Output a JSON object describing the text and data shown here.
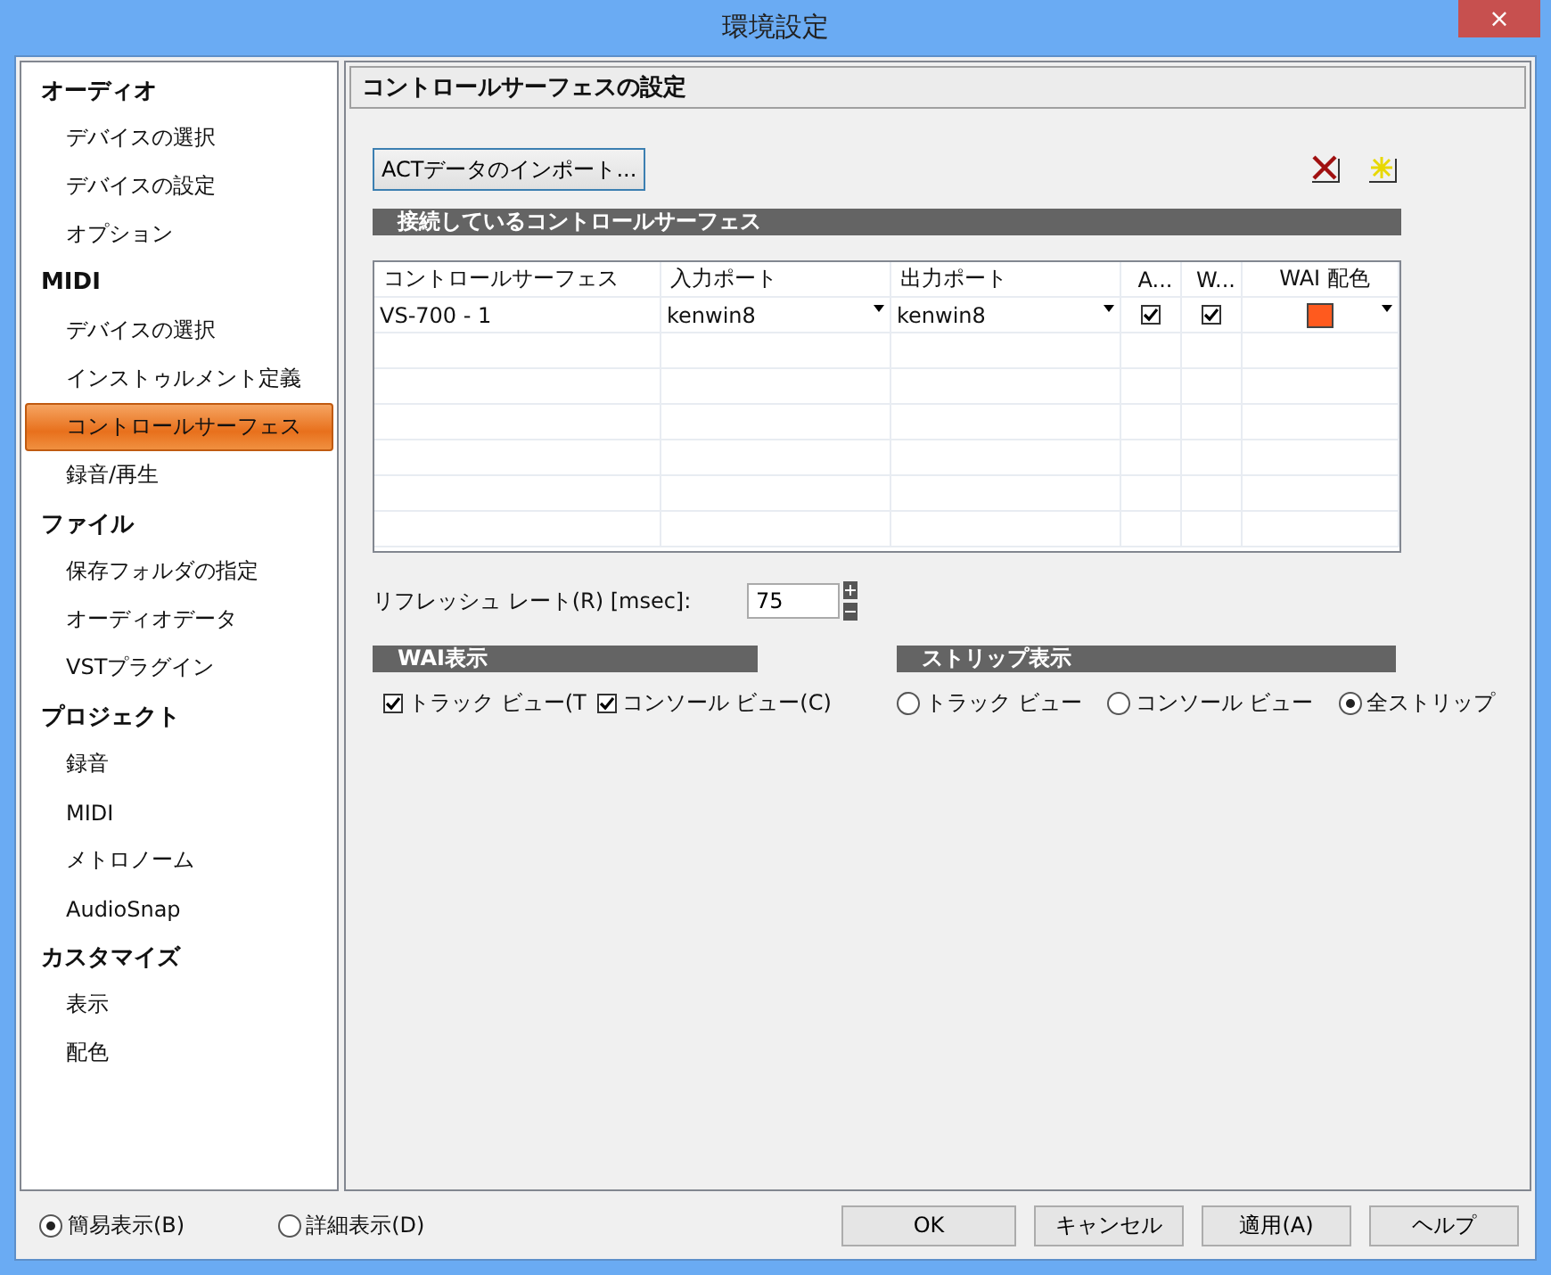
{
  "window": {
    "title": "環境設定",
    "close": "×"
  },
  "sidebar": {
    "items": [
      {
        "label": "オーディオ",
        "selected": false,
        "children": [
          {
            "label": "デバイスの選択",
            "selected": false
          },
          {
            "label": "デバイスの設定",
            "selected": false
          },
          {
            "label": "オプション",
            "selected": false
          }
        ]
      },
      {
        "label": "MIDI",
        "selected": false,
        "children": [
          {
            "label": "デバイスの選択",
            "selected": false
          },
          {
            "label": "インストゥルメント定義",
            "selected": false
          },
          {
            "label": "コントロールサーフェス",
            "selected": true
          },
          {
            "label": "録音/再生",
            "selected": false
          }
        ]
      },
      {
        "label": "ファイル",
        "selected": false,
        "children": [
          {
            "label": "保存フォルダの指定",
            "selected": false
          },
          {
            "label": "オーディオデータ",
            "selected": false
          },
          {
            "label": "VSTプラグイン",
            "selected": false
          }
        ]
      },
      {
        "label": "プロジェクト",
        "selected": false,
        "children": [
          {
            "label": "録音",
            "selected": false
          },
          {
            "label": "MIDI",
            "selected": false
          },
          {
            "label": "メトロノーム",
            "selected": false
          },
          {
            "label": "AudioSnap",
            "selected": false
          }
        ]
      },
      {
        "label": "カスタマイズ",
        "selected": false,
        "children": [
          {
            "label": "表示",
            "selected": false
          },
          {
            "label": "配色",
            "selected": false
          }
        ]
      }
    ]
  },
  "panel": {
    "title": "コントロールサーフェスの設定",
    "import_button": "ACTデータのインポート...",
    "section_title": "接続しているコントロールサーフェス",
    "table": {
      "columns": [
        "コントロールサーフェス",
        "入力ポート",
        "出力ポート",
        "A...",
        "W...",
        "WAI 配色"
      ],
      "rows": [
        {
          "name": "VS-700 - 1",
          "input": "kenwin8",
          "output": "kenwin8",
          "a_checked": true,
          "w_checked": true,
          "color": "#ff5a1e"
        }
      ]
    },
    "refresh_label": "リフレッシュ レート(R) [msec]:",
    "refresh_value": "75",
    "wai": {
      "title": "WAI表示",
      "options": [
        {
          "label": "トラック ビュー(T",
          "checked": true
        },
        {
          "label": "コンソール ビュー(C)",
          "checked": true
        }
      ]
    },
    "strip": {
      "title": "ストリップ表示",
      "options": [
        {
          "label": "トラック ビュー",
          "selected": false
        },
        {
          "label": "コンソール ビュー",
          "selected": false
        },
        {
          "label": "全ストリップ",
          "selected": true
        }
      ]
    }
  },
  "footer": {
    "modes": [
      {
        "label": "簡易表示(B)",
        "selected": true
      },
      {
        "label": "詳細表示(D)",
        "selected": false
      }
    ],
    "buttons": [
      "OK",
      "キャンセル",
      "適用(A)",
      "ヘルプ"
    ]
  }
}
